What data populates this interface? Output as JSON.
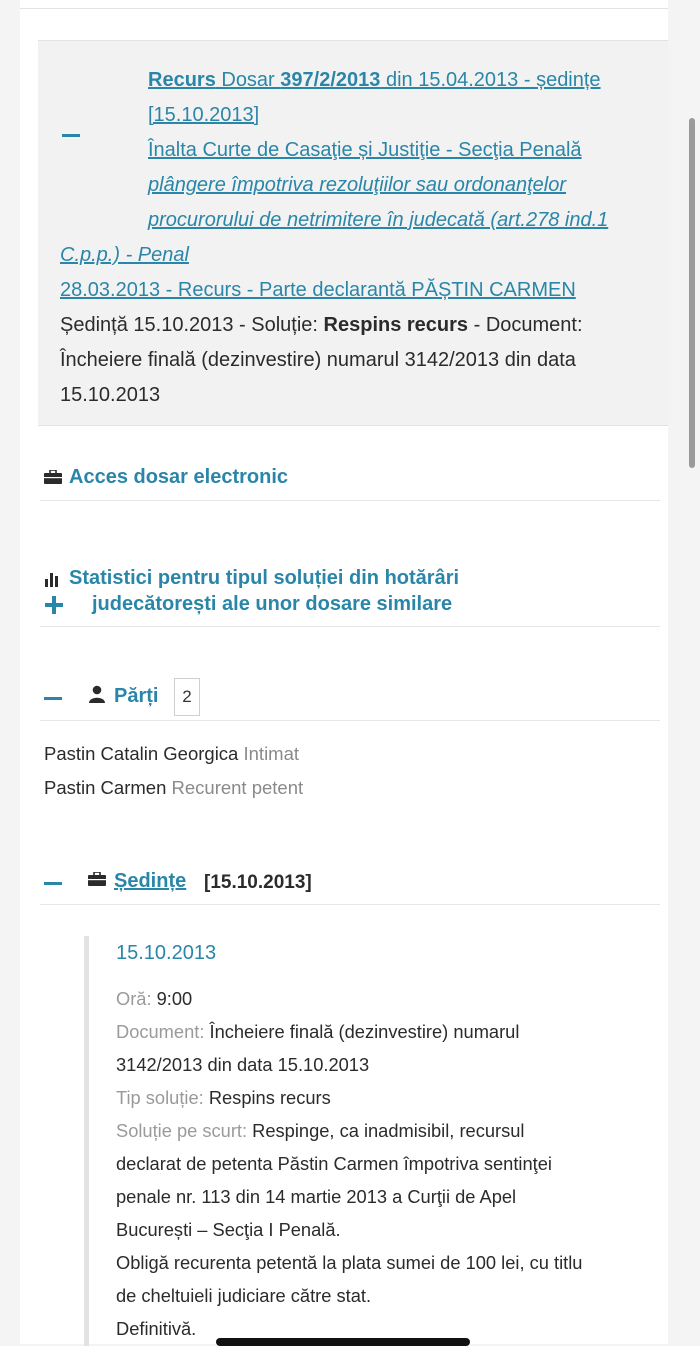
{
  "case": {
    "title_recurs": "Recurs",
    "title_dosar": " Dosar ",
    "title_number": "397/2/2013",
    "title_date_part": " din 15.04.2013 - ședințe",
    "title_hearings": "[15.10.2013]",
    "court": "Înalta Curte de Casaţie și Justiţie - Secţia Penală",
    "object_line1": "plângere împotriva rezoluţiilor sau ordonanţelor",
    "object_line2": "procurorului de netrimitere în judecată (art.278 ind.1",
    "object_line3": "C.p.p.) - Penal",
    "filing": "28.03.2013 - Recurs - Parte declarantă PĂȘTIN CARMEN",
    "session_prefix": "Ședință 15.10.2013 - Soluție: ",
    "session_solution": "Respins recurs",
    "session_suffix": " - Document:",
    "session_doc_line2": "Încheiere finală (dezinvestire) numarul 3142/2013 din data",
    "session_doc_line3": "15.10.2013"
  },
  "acces": {
    "label": "Acces dosar electronic",
    "icon": "briefcase-icon"
  },
  "statistici": {
    "line1": "Statistici pentru tipul soluției din hotărâri",
    "line2": "judecătorești ale unor dosare similare",
    "icon": "bar-chart-icon"
  },
  "parti": {
    "label": "Părți",
    "count": "2",
    "items": [
      {
        "name": "Pastin Catalin Georgica",
        "role": "Intimat"
      },
      {
        "name": "Pastin Carmen",
        "role": "Recurent petent"
      }
    ]
  },
  "sedinte": {
    "label": "Ședințe",
    "dates": "[15.10.2013]",
    "entry": {
      "date": "15.10.2013",
      "ora_label": "Oră: ",
      "ora_value": "9:00",
      "document_label": "Document: ",
      "document_line1": "Încheiere finală (dezinvestire) numarul",
      "document_line2": "3142/2013 din data 15.10.2013",
      "tip_label": "Tip soluție: ",
      "tip_value": "Respins recurs",
      "scurt_label": "Soluție pe scurt: ",
      "scurt_line1": "Respinge, ca inadmisibil, recursul",
      "scurt_line2": "declarat de petenta Păstin Carmen împotriva sentinţei",
      "scurt_line3": "penale nr. 113 din 14 martie 2013 a Curţii de Apel",
      "scurt_line4": "București – Secţia I Penală.",
      "scurt_line5": "Obligă recurenta petentă la plata sumei de 100 lei, cu titlu",
      "scurt_line6": "de cheltuieli judiciare către stat.",
      "scurt_line7": "Definitivă."
    }
  },
  "colors": {
    "link": "#2a86a8",
    "label_gray": "#9a9a9a",
    "panel": "#f2f2f2"
  }
}
